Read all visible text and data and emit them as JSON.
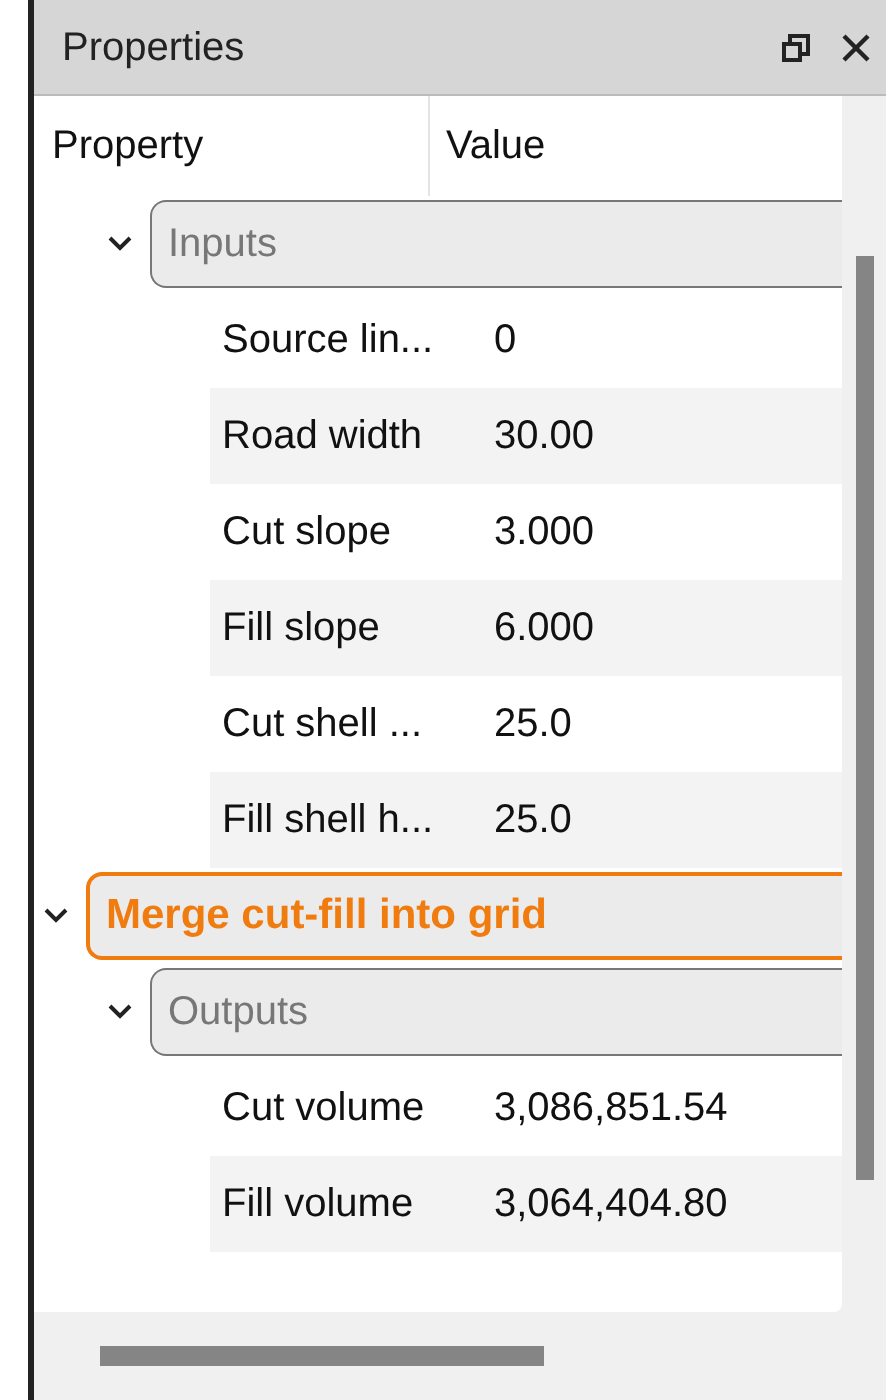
{
  "window": {
    "title": "Properties"
  },
  "columns": [
    "Property",
    "Value"
  ],
  "tree": [
    {
      "kind": "section",
      "label": "Inputs",
      "expanded": true,
      "children": [
        {
          "kind": "property",
          "name": "Source lin...",
          "value": "0"
        },
        {
          "kind": "property",
          "name": "Road width",
          "value": "30.00"
        },
        {
          "kind": "property",
          "name": "Cut slope",
          "value": "3.000"
        },
        {
          "kind": "property",
          "name": "Fill slope",
          "value": "6.000"
        },
        {
          "kind": "property",
          "name": "Cut shell ...",
          "value": "25.0"
        },
        {
          "kind": "property",
          "name": "Fill shell h...",
          "value": "25.0"
        }
      ]
    },
    {
      "kind": "step",
      "label": "Merge cut-fill into grid",
      "expanded": true,
      "children": [
        {
          "kind": "section",
          "label": "Outputs",
          "expanded": true,
          "children": [
            {
              "kind": "property",
              "name": "Cut volume",
              "value": "3,086,851.54"
            },
            {
              "kind": "property",
              "name": "Fill volume",
              "value": "3,064,404.80"
            }
          ]
        }
      ]
    }
  ]
}
